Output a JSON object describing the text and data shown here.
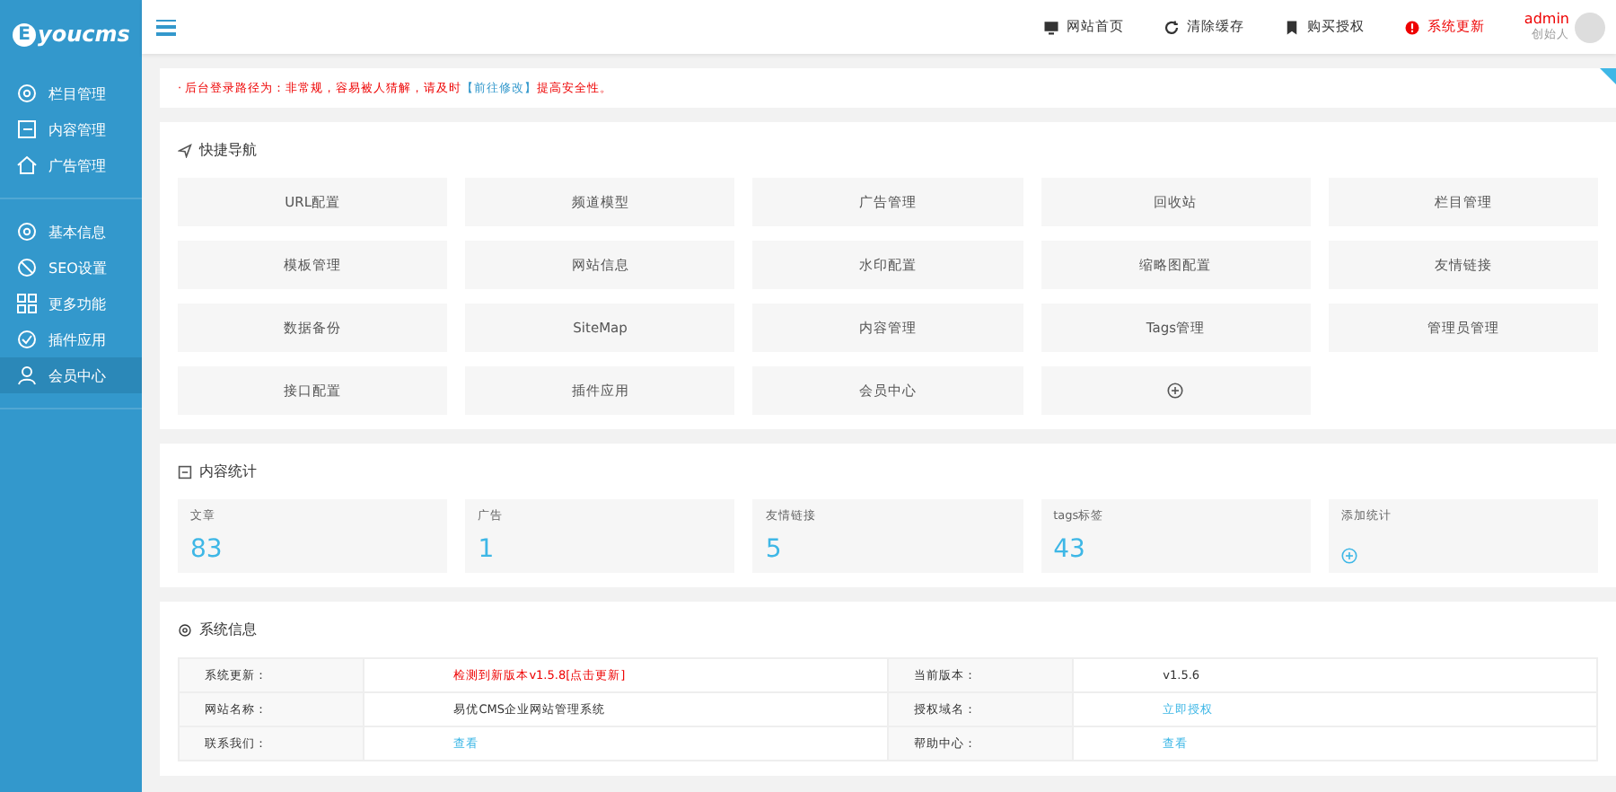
{
  "sidebar": {
    "logo": {
      "mark": "E",
      "text": "youcms"
    },
    "groups": [
      [
        {
          "label": "栏目管理",
          "selected": false
        },
        {
          "label": "内容管理",
          "selected": false
        },
        {
          "label": "广告管理",
          "selected": false
        }
      ],
      [
        {
          "label": "基本信息",
          "selected": false
        },
        {
          "label": "SEO设置",
          "selected": false
        },
        {
          "label": "更多功能",
          "selected": false
        },
        {
          "label": "插件应用",
          "selected": false
        },
        {
          "label": "会员中心",
          "selected": true
        }
      ]
    ]
  },
  "topbar": {
    "links": [
      {
        "label": "网站首页",
        "kind": "normal"
      },
      {
        "label": "清除缓存",
        "kind": "normal"
      },
      {
        "label": "购买授权",
        "kind": "normal"
      },
      {
        "label": "系统更新",
        "kind": "alert"
      }
    ],
    "user": {
      "name": "admin",
      "role": "创始人"
    }
  },
  "notice": {
    "bullet": "·",
    "before": "后台登录路径为：非常规，容易被人猜解，请及时",
    "link": "【前往修改】",
    "after": "提高安全性。"
  },
  "quick_nav": {
    "title": "快捷导航",
    "items": [
      {
        "label": "URL配置",
        "kind": "text"
      },
      {
        "label": "频道模型",
        "kind": "text"
      },
      {
        "label": "广告管理",
        "kind": "text"
      },
      {
        "label": "回收站",
        "kind": "text"
      },
      {
        "label": "栏目管理",
        "kind": "text"
      },
      {
        "label": "模板管理",
        "kind": "text"
      },
      {
        "label": "网站信息",
        "kind": "text"
      },
      {
        "label": "水印配置",
        "kind": "text"
      },
      {
        "label": "缩略图配置",
        "kind": "text"
      },
      {
        "label": "友情链接",
        "kind": "text"
      },
      {
        "label": "数据备份",
        "kind": "text"
      },
      {
        "label": "SiteMap",
        "kind": "text"
      },
      {
        "label": "内容管理",
        "kind": "text"
      },
      {
        "label": "Tags管理",
        "kind": "text"
      },
      {
        "label": "管理员管理",
        "kind": "text"
      },
      {
        "label": "接口配置",
        "kind": "text"
      },
      {
        "label": "插件应用",
        "kind": "text"
      },
      {
        "label": "会员中心",
        "kind": "text"
      },
      {
        "kind": "add"
      }
    ]
  },
  "stats": {
    "title": "内容统计",
    "items": [
      {
        "label": "文章",
        "value": "83",
        "kind": "value"
      },
      {
        "label": "广告",
        "value": "1",
        "kind": "value"
      },
      {
        "label": "友情链接",
        "value": "5",
        "kind": "value"
      },
      {
        "label": "tags标签",
        "value": "43",
        "kind": "value"
      },
      {
        "label": "添加统计",
        "kind": "add"
      }
    ]
  },
  "system_info": {
    "title": "系统信息",
    "rows": [
      [
        {
          "label": "系统更新：",
          "value": "检测到新版本v1.5.8[点击更新]",
          "kind": "alert"
        },
        {
          "label": "当前版本：",
          "value": "v1.5.6",
          "kind": "text"
        }
      ],
      [
        {
          "label": "网站名称：",
          "value": "易优CMS企业网站管理系统",
          "kind": "text"
        },
        {
          "label": "授权域名：",
          "value": "立即授权",
          "kind": "link"
        }
      ],
      [
        {
          "label": "联系我们：",
          "value": "查看",
          "kind": "link"
        },
        {
          "label": "帮助中心：",
          "value": "查看",
          "kind": "link"
        }
      ]
    ]
  }
}
